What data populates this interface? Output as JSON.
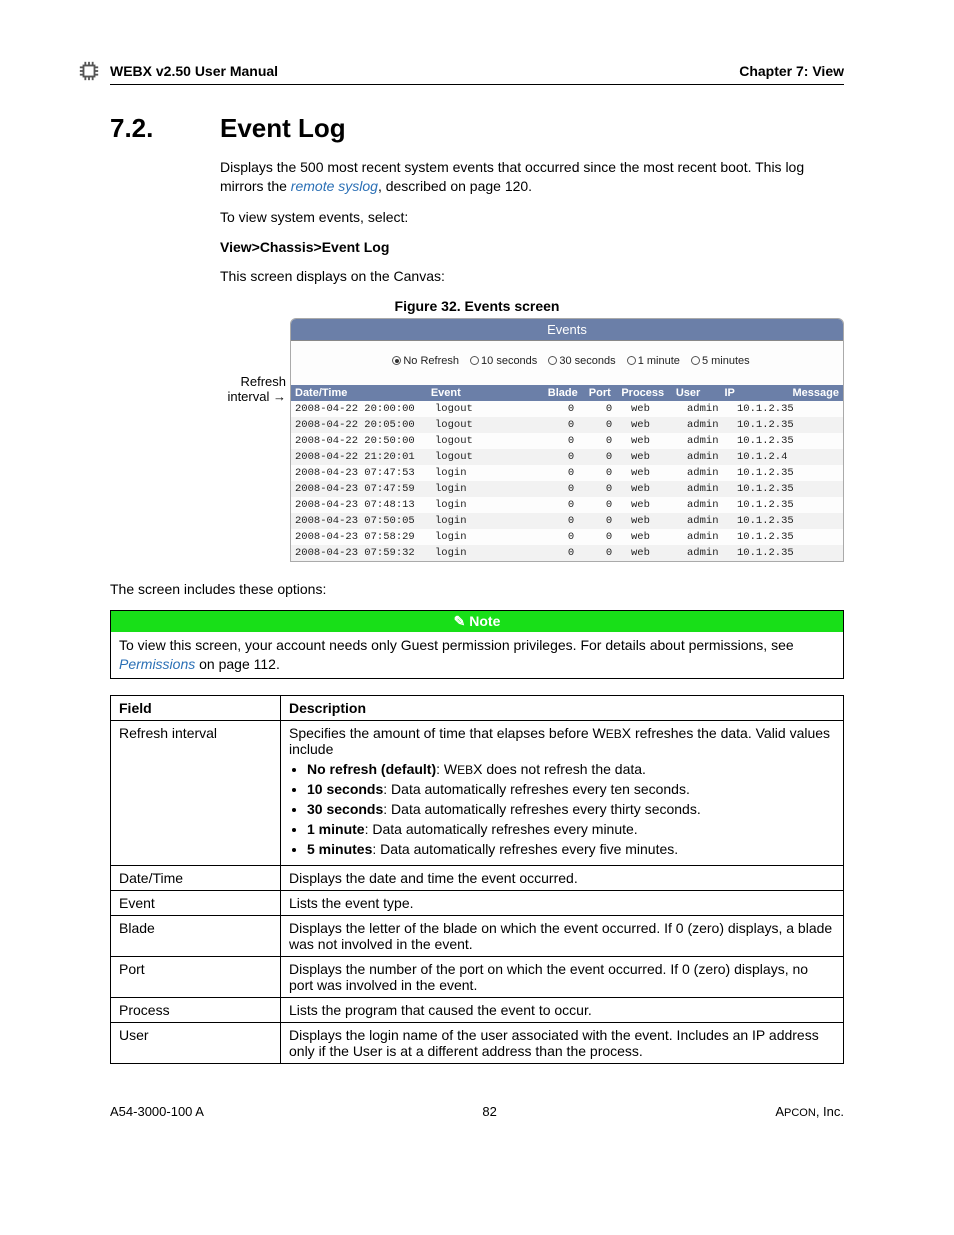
{
  "header": {
    "left": "WEBX v2.50 User Manual",
    "right": "Chapter 7: View"
  },
  "section": {
    "num": "7.2.",
    "title": "Event Log"
  },
  "intro1a": "Displays the 500 most recent system events that occurred since the most recent boot. This log mirrors the ",
  "intro1_link": "remote syslog",
  "intro1b": ", described on page 120.",
  "intro2": "To view system events, select:",
  "navpath": "View>Chassis>Event Log",
  "intro3": "This screen displays on the Canvas:",
  "fig_caption": "Figure 32. Events screen",
  "callout": "Refresh interval",
  "events_panel": {
    "title": "Events",
    "refresh_options": [
      "No Refresh",
      "10 seconds",
      "30 seconds",
      "1 minute",
      "5 minutes"
    ],
    "columns": {
      "dt": "Date/Time",
      "ev": "Event",
      "bl": "Blade",
      "po": "Port",
      "pr": "Process",
      "us": "User",
      "ip": "IP",
      "msg": "Message"
    },
    "rows": [
      {
        "dt": "2008-04-22 20:00:00",
        "ev": "logout",
        "bl": "0",
        "po": "0",
        "pr": "web",
        "us": "admin",
        "ip": "10.1.2.35",
        "msg": ""
      },
      {
        "dt": "2008-04-22 20:05:00",
        "ev": "logout",
        "bl": "0",
        "po": "0",
        "pr": "web",
        "us": "admin",
        "ip": "10.1.2.35",
        "msg": ""
      },
      {
        "dt": "2008-04-22 20:50:00",
        "ev": "logout",
        "bl": "0",
        "po": "0",
        "pr": "web",
        "us": "admin",
        "ip": "10.1.2.35",
        "msg": ""
      },
      {
        "dt": "2008-04-22 21:20:01",
        "ev": "logout",
        "bl": "0",
        "po": "0",
        "pr": "web",
        "us": "admin",
        "ip": "10.1.2.4",
        "msg": ""
      },
      {
        "dt": "2008-04-23 07:47:53",
        "ev": "login",
        "bl": "0",
        "po": "0",
        "pr": "web",
        "us": "admin",
        "ip": "10.1.2.35",
        "msg": ""
      },
      {
        "dt": "2008-04-23 07:47:59",
        "ev": "login",
        "bl": "0",
        "po": "0",
        "pr": "web",
        "us": "admin",
        "ip": "10.1.2.35",
        "msg": ""
      },
      {
        "dt": "2008-04-23 07:48:13",
        "ev": "login",
        "bl": "0",
        "po": "0",
        "pr": "web",
        "us": "admin",
        "ip": "10.1.2.35",
        "msg": ""
      },
      {
        "dt": "2008-04-23 07:50:05",
        "ev": "login",
        "bl": "0",
        "po": "0",
        "pr": "web",
        "us": "admin",
        "ip": "10.1.2.35",
        "msg": ""
      },
      {
        "dt": "2008-04-23 07:58:29",
        "ev": "login",
        "bl": "0",
        "po": "0",
        "pr": "web",
        "us": "admin",
        "ip": "10.1.2.35",
        "msg": ""
      },
      {
        "dt": "2008-04-23 07:59:32",
        "ev": "login",
        "bl": "0",
        "po": "0",
        "pr": "web",
        "us": "admin",
        "ip": "10.1.2.35",
        "msg": ""
      }
    ]
  },
  "options_intro": "The screen includes these options:",
  "note": {
    "heading": "Note",
    "text_a": "To view this screen, your account needs only Guest permission privileges. For details about permissions, see ",
    "link": "Permissions",
    "text_b": " on page 112."
  },
  "field_table": {
    "head_field": "Field",
    "head_desc": "Description",
    "refresh": {
      "name": "Refresh interval",
      "lead_a": "Specifies the amount of time that elapses before W",
      "lead_b": "EB",
      "lead_c": "X refreshes the data. Valid values include",
      "opts": [
        {
          "b": "No refresh (default)",
          "t_a": ": W",
          "t_sc": "EB",
          "t_b": "X does not refresh the data."
        },
        {
          "b": "10 seconds",
          "t": ": Data automatically refreshes every ten seconds."
        },
        {
          "b": "30 seconds",
          "t": ": Data automatically refreshes every thirty seconds."
        },
        {
          "b": "1 minute",
          "t": ": Data automatically refreshes every minute."
        },
        {
          "b": "5 minutes",
          "t": ": Data automatically refreshes every five minutes."
        }
      ]
    },
    "rows": [
      {
        "f": "Date/Time",
        "d": "Displays the date and time the event occurred."
      },
      {
        "f": "Event",
        "d": "Lists the event type."
      },
      {
        "f": "Blade",
        "d": "Displays the letter of the blade on which the event occurred. If 0 (zero) displays, a blade was not involved in the event."
      },
      {
        "f": "Port",
        "d": "Displays the number of the port on which the event occurred. If 0 (zero) displays, no port was involved in the event."
      },
      {
        "f": "Process",
        "d": "Lists the program that caused the event to occur."
      },
      {
        "f": "User",
        "d": "Displays the login name of the user associated with the event. Includes an IP address only if the User is at a different address than the process."
      }
    ]
  },
  "footer": {
    "left": "A54-3000-100 A",
    "mid": "82",
    "right_a": "A",
    "right_sc": "PCON",
    "right_b": ", Inc."
  }
}
